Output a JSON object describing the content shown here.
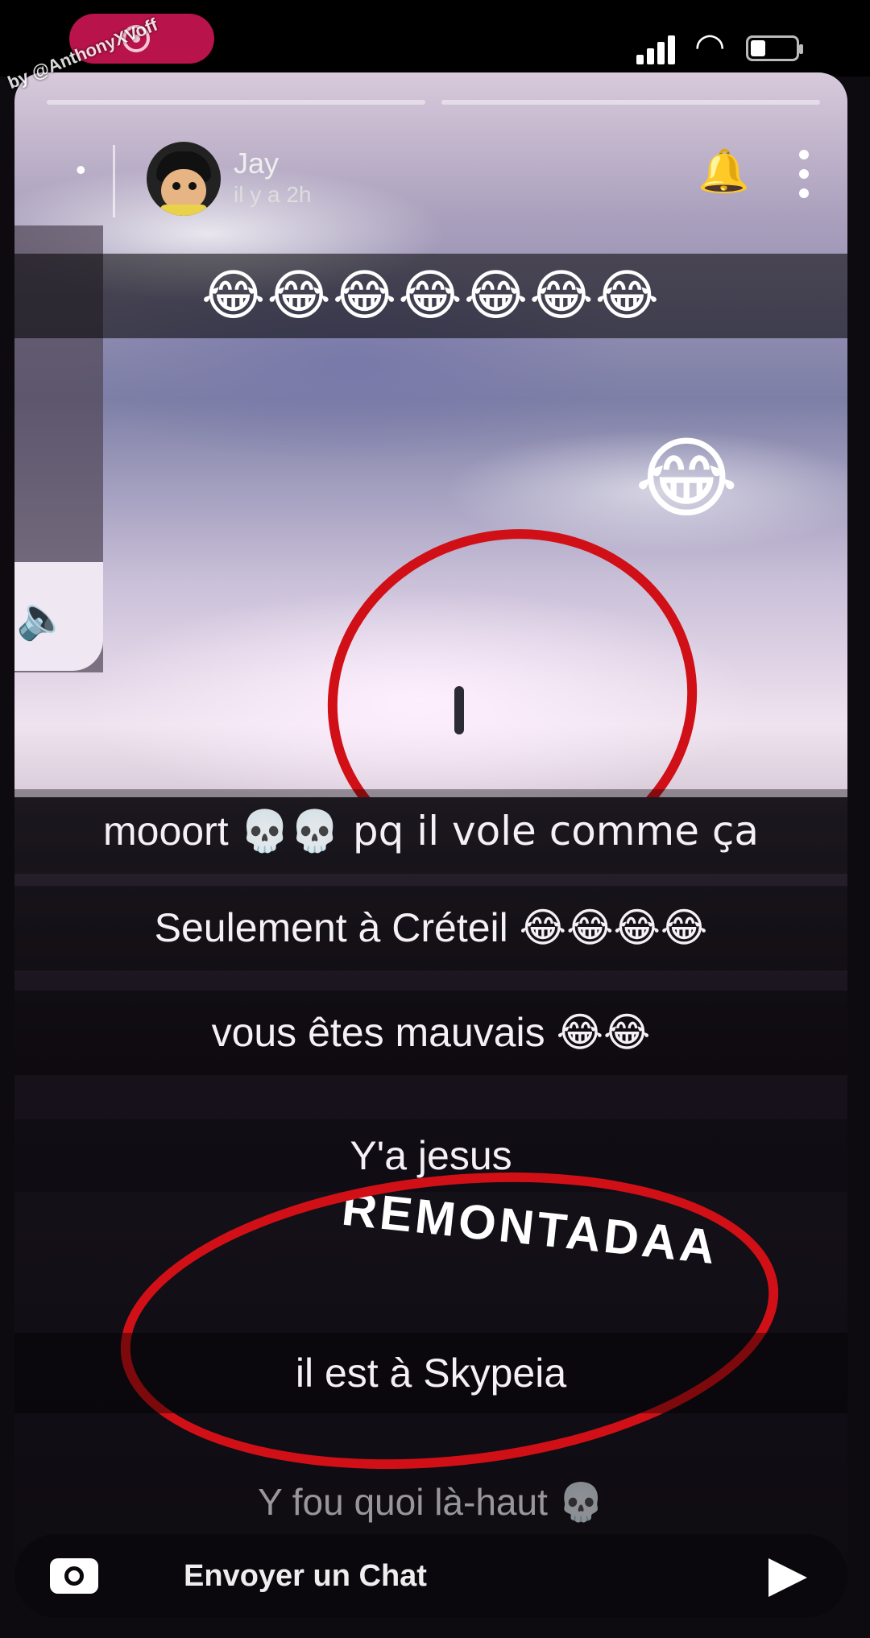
{
  "watermark": "by @AnthonyXVoff",
  "story": {
    "sender": "Jay",
    "time": "il y a 2h",
    "progress_segments": 2
  },
  "emojis": {
    "laugh": "😂",
    "skull": "💀"
  },
  "captions": [
    {
      "text": "mooort",
      "after": "💀💀 pq il vole comme ça"
    },
    {
      "text": "Seulement à Créteil",
      "after": "😂😂😂😂"
    },
    {
      "text": "vous êtes mauvais",
      "after": "😂😂"
    },
    {
      "text": "Y'a jesus"
    },
    {
      "text": "REMONTADAA"
    },
    {
      "text": "il est à Skypeia"
    },
    {
      "text": "Y fou quoi là-haut 💀"
    }
  ],
  "composer": {
    "placeholder": "Envoyer un Chat"
  },
  "colors": {
    "record_pill": "#b8134a",
    "annotation_red": "#d01016"
  }
}
